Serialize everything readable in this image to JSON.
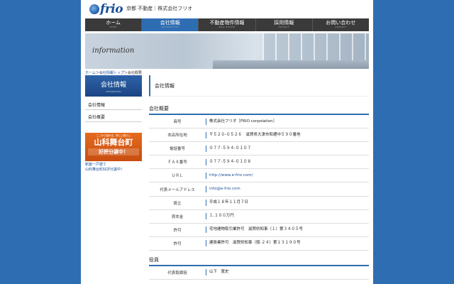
{
  "header": {
    "logo_text": "frio",
    "tagline": "京都 不動産｜株式会社フリオ"
  },
  "nav": [
    {
      "label": "ホーム",
      "sub": "HOME"
    },
    {
      "label": "会社情報",
      "sub": "INFORMATION"
    },
    {
      "label": "不動産物件情報",
      "sub": "REAL ESTATE"
    },
    {
      "label": "採用情報",
      "sub": "RECRUIT"
    },
    {
      "label": "お問い合わせ",
      "sub": "CONTACT"
    }
  ],
  "banner": {
    "title": "information"
  },
  "breadcrumb": {
    "home": "ホーム",
    "sep1": "＞",
    "company_top": "会社情報トップ",
    "sep2": "＞",
    "current": "会社概要"
  },
  "sidebar": {
    "head_title": "会社情報",
    "head_sub": "INFORMATION",
    "links": [
      "会社情報",
      "会社概要"
    ],
    "promo_small": "ここから始める、新しい暮らし",
    "promo_big": "山科舞台町",
    "promo_foot": "好評分譲中！",
    "promo_note_1": "新築一戸建て",
    "promo_note_2": "山科舞台町好評分譲中！"
  },
  "main": {
    "title": "会社情報",
    "section1": "会社概要",
    "rows": [
      {
        "label": "商号",
        "value": "株式会社フリオ［FRIO corpolation］"
      },
      {
        "label": "本店所在地",
        "value": "〒５２０-０５２６　滋賀県大津市和邇中５９０番地"
      },
      {
        "label": "電話番号",
        "value": "０７７-５９４-０１０７"
      },
      {
        "label": "ＦＡＸ番号",
        "value": "０７７-５９４-０１０８"
      },
      {
        "label": "ＵＲＬ",
        "value": "http://www.e-frio.com/"
      },
      {
        "label": "代表メールアドレス",
        "value": "info@e-frio.com"
      },
      {
        "label": "設立",
        "value": "平成１８年１１月７日"
      },
      {
        "label": "資本金",
        "value": "１,１００万円"
      },
      {
        "label": "許可",
        "value": "宅地建物取引業許可　滋賀県知事（１）第３４０５号"
      },
      {
        "label": "許可",
        "value": "建設業許可　滋賀県知事（般-２４）第１３１９０号"
      }
    ],
    "section2": "役員",
    "officer_label": "代表取締役",
    "officer_value": "山下　寛史"
  }
}
